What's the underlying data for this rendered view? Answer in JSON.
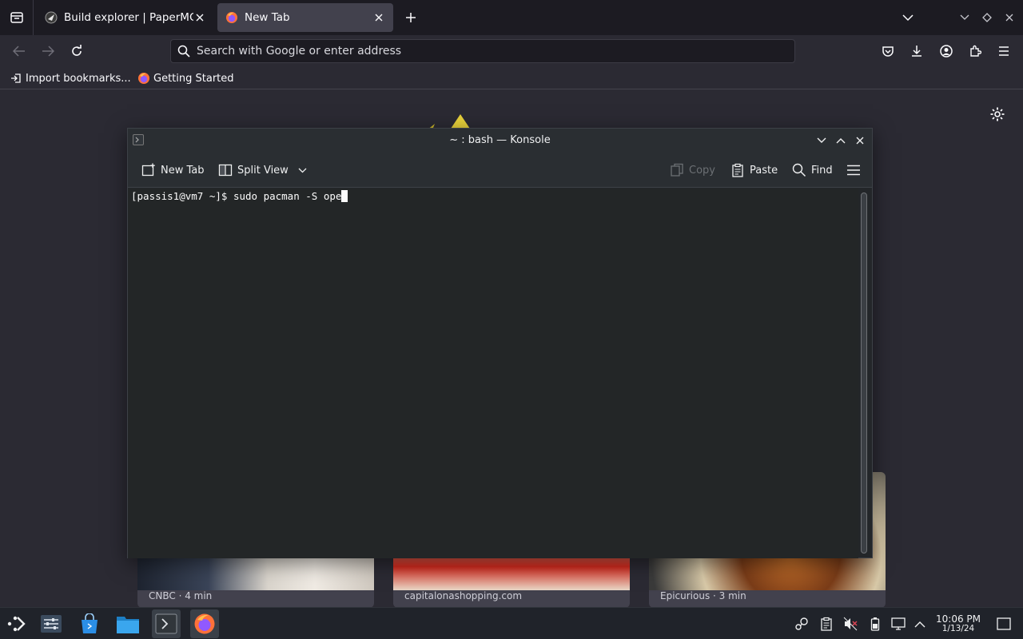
{
  "browser": {
    "tabs": [
      {
        "label": "Build explorer | PaperMC",
        "icon": "papermc-icon",
        "active": false
      },
      {
        "label": "New Tab",
        "icon": "firefox-icon",
        "active": true
      }
    ],
    "url_placeholder": "Search with Google or enter address",
    "bookmarks": [
      {
        "label": "Import bookmarks...",
        "icon": "import-icon"
      },
      {
        "label": "Getting Started",
        "icon": "firefox-icon"
      }
    ],
    "cards": [
      {
        "source": "CNBC · 4 min"
      },
      {
        "source": "capitalonashopping.com"
      },
      {
        "source": "Epicurious · 3 min"
      }
    ],
    "colors": {
      "accent": "#3daee9",
      "toolbar": "#1c1b22",
      "background": "#2b2a33"
    }
  },
  "konsole": {
    "title": "~ : bash — Konsole",
    "toolbar": {
      "new_tab": "New Tab",
      "split_view": "Split View",
      "copy": "Copy",
      "paste": "Paste",
      "find": "Find"
    },
    "prompt": "[passis1@vm7 ~]$ ",
    "command": "sudo pacman -S ope"
  },
  "taskbar": {
    "clock_time": "10:06 PM",
    "clock_date": "1/13/24"
  }
}
